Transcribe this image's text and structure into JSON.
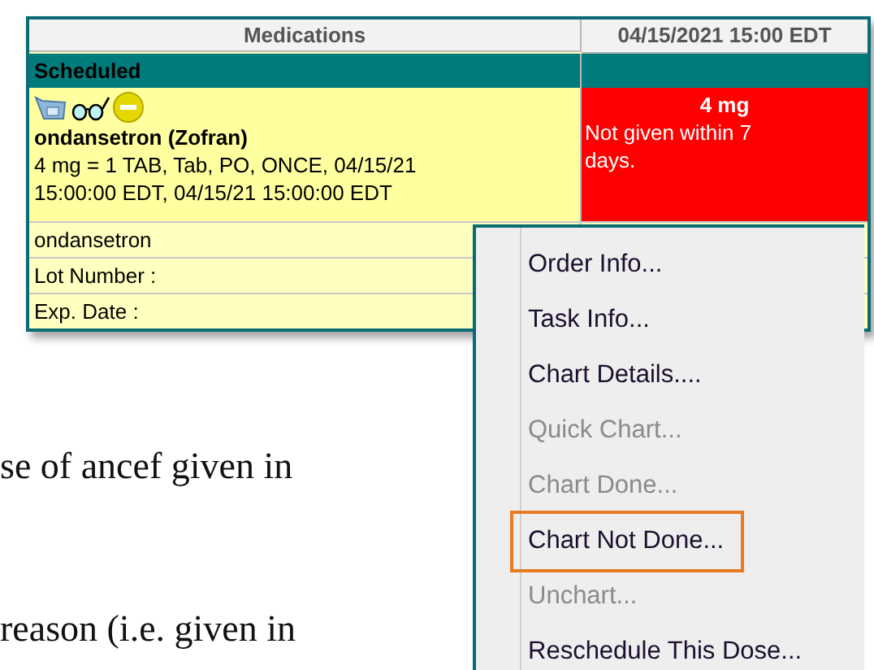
{
  "grid": {
    "columns": [
      "Medications",
      "04/15/2021 15:00 EDT"
    ],
    "section": {
      "label": "Scheduled"
    },
    "order": {
      "name": "ondansetron (Zofran)",
      "details": "4 mg = 1 TAB, Tab, PO, ONCE, 04/15/21 15:00:00 EDT, 04/15/21 15:00:00 EDT"
    },
    "result": {
      "dose": "4 mg",
      "note": "Not given within 7 days."
    },
    "fields": [
      "ondansetron",
      "Lot Number :",
      "Exp. Date :"
    ]
  },
  "document": {
    "lines": [
      "se of ancef given in",
      "reason (i.e. given in"
    ]
  },
  "context_menu": {
    "items": [
      {
        "label": "Order Info...",
        "disabled": false,
        "highlighted": false
      },
      {
        "label": "Task Info...",
        "disabled": false,
        "highlighted": false
      },
      {
        "label": "Chart Details....",
        "disabled": false,
        "highlighted": false
      },
      {
        "label": "Quick Chart...",
        "disabled": true,
        "highlighted": false
      },
      {
        "label": "Chart Done...",
        "disabled": true,
        "highlighted": false
      },
      {
        "label": "Chart Not Done...",
        "disabled": false,
        "highlighted": true
      },
      {
        "label": "Unchart...",
        "disabled": true,
        "highlighted": false
      },
      {
        "label": "Reschedule This Dose...",
        "disabled": false,
        "highlighted": false
      }
    ]
  }
}
